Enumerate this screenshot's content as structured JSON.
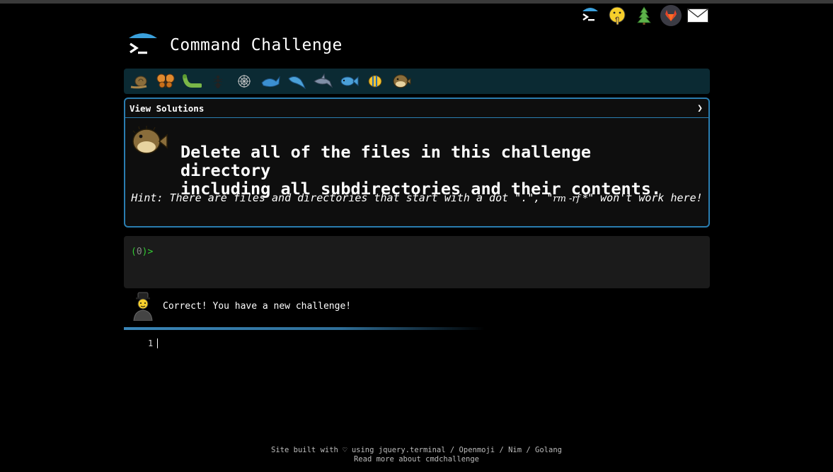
{
  "top_icons": [
    {
      "name": "terminal-logo-icon"
    },
    {
      "name": "shushing-face-icon"
    },
    {
      "name": "tree-icon"
    },
    {
      "name": "gitlab-icon"
    },
    {
      "name": "envelope-icon"
    }
  ],
  "header": {
    "title": "Command Challenge"
  },
  "animals": [
    {
      "name": "snail-icon"
    },
    {
      "name": "butterfly-icon"
    },
    {
      "name": "caterpillar-icon"
    },
    {
      "name": "ant-icon"
    },
    {
      "name": "spider-web-icon"
    },
    {
      "name": "whale-icon"
    },
    {
      "name": "dolphin-icon"
    },
    {
      "name": "shark-icon"
    },
    {
      "name": "fish-icon"
    },
    {
      "name": "tropical-fish-icon"
    },
    {
      "name": "blowfish-icon"
    }
  ],
  "challenge": {
    "view_solutions": "View Solutions",
    "chevron": "❯",
    "line1": "Delete all of the files in this challenge directory",
    "line2": "including all subdirectories and their contents.",
    "hint_prefix": "Hint: There are files and directories that start with a dot \".\", \"",
    "hint_code": "rm -rf *",
    "hint_suffix": "\" won't work here!"
  },
  "terminal": {
    "open": "(",
    "count": "0",
    "close": ")>"
  },
  "result": {
    "message": "Correct! You have a new challenge!"
  },
  "editor": {
    "line_number": "1"
  },
  "footer": {
    "line1_prefix": "Site built with ♡ using ",
    "jquery": "jquery.terminal",
    "sep1": " / ",
    "openmoji": "Openmoji",
    "sep2": " / ",
    "nim": "Nim",
    "sep3": " / ",
    "golang": "Golang",
    "read_more": "Read more about cmdchallenge"
  },
  "colors": {
    "accent": "#2a7db0",
    "bar": "#0b2a33",
    "prompt": "#33cc33"
  }
}
